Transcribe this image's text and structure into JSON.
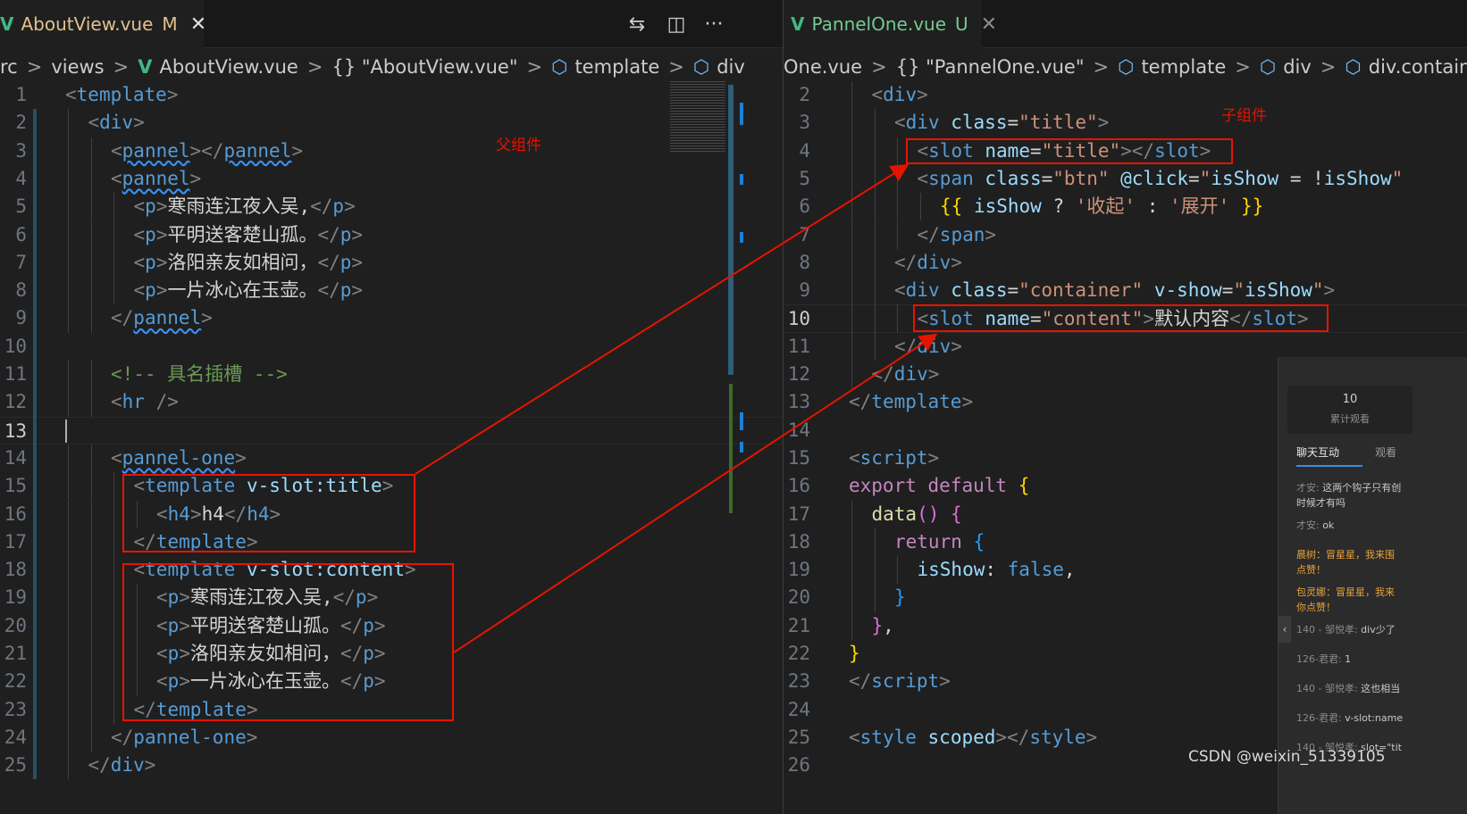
{
  "left": {
    "tab": {
      "name": "AboutView.vue",
      "status": "M",
      "close": "✕"
    },
    "toolbar": {
      "compare": "⇆",
      "split": "◫",
      "more": "···"
    },
    "breadcrumb": [
      "rc",
      "views",
      "AboutView.vue",
      "{} \"AboutView.vue\"",
      "template",
      "div"
    ],
    "line_numbers": [
      "1",
      "2",
      "3",
      "4",
      "5",
      "6",
      "7",
      "8",
      "9",
      "10",
      "11",
      "12",
      "13",
      "14",
      "15",
      "16",
      "17",
      "18",
      "19",
      "20",
      "21",
      "22",
      "23",
      "24",
      "25"
    ],
    "current_line": "13",
    "annotation": "父组件",
    "lines": [
      [
        [
          "t-br",
          "<"
        ],
        [
          "t-tag",
          "template"
        ],
        [
          "t-br",
          ">"
        ]
      ],
      [
        [
          "t-br",
          "<"
        ],
        [
          "t-tag",
          "div"
        ],
        [
          "t-br",
          ">"
        ]
      ],
      [
        [
          "t-br",
          "<"
        ],
        [
          "t-tag squig",
          "pannel"
        ],
        [
          "t-br",
          "></"
        ],
        [
          "t-tag squig",
          "pannel"
        ],
        [
          "t-br",
          ">"
        ]
      ],
      [
        [
          "t-br",
          "<"
        ],
        [
          "t-tag squig",
          "pannel"
        ],
        [
          "t-br",
          ">"
        ]
      ],
      [
        [
          "t-br",
          "<"
        ],
        [
          "t-tag",
          "p"
        ],
        [
          "t-br",
          ">"
        ],
        [
          "t-txt",
          "寒雨连江夜入吴,"
        ],
        [
          "t-br",
          "</"
        ],
        [
          "t-tag",
          "p"
        ],
        [
          "t-br",
          ">"
        ]
      ],
      [
        [
          "t-br",
          "<"
        ],
        [
          "t-tag",
          "p"
        ],
        [
          "t-br",
          ">"
        ],
        [
          "t-txt",
          "平明送客楚山孤。"
        ],
        [
          "t-br",
          "</"
        ],
        [
          "t-tag",
          "p"
        ],
        [
          "t-br",
          ">"
        ]
      ],
      [
        [
          "t-br",
          "<"
        ],
        [
          "t-tag",
          "p"
        ],
        [
          "t-br",
          ">"
        ],
        [
          "t-txt",
          "洛阳亲友如相问，"
        ],
        [
          "t-br",
          "</"
        ],
        [
          "t-tag",
          "p"
        ],
        [
          "t-br",
          ">"
        ]
      ],
      [
        [
          "t-br",
          "<"
        ],
        [
          "t-tag",
          "p"
        ],
        [
          "t-br",
          ">"
        ],
        [
          "t-txt",
          "一片冰心在玉壶。"
        ],
        [
          "t-br",
          "</"
        ],
        [
          "t-tag",
          "p"
        ],
        [
          "t-br",
          ">"
        ]
      ],
      [
        [
          "t-br",
          "</"
        ],
        [
          "t-tag squig",
          "pannel"
        ],
        [
          "t-br",
          ">"
        ]
      ],
      [],
      [
        [
          "t-com",
          "<!-- 具名插槽 -->"
        ]
      ],
      [
        [
          "t-br",
          "<"
        ],
        [
          "t-tag",
          "hr"
        ],
        [
          "t-txt",
          " "
        ],
        [
          "t-br",
          "/>"
        ]
      ],
      [],
      [
        [
          "t-br",
          "<"
        ],
        [
          "t-tag squig",
          "pannel-one"
        ],
        [
          "t-br",
          ">"
        ]
      ],
      [
        [
          "t-br",
          "<"
        ],
        [
          "t-tag",
          "template"
        ],
        [
          "t-txt",
          " "
        ],
        [
          "t-attr",
          "v-slot:title"
        ],
        [
          "t-br",
          ">"
        ]
      ],
      [
        [
          "t-br",
          "<"
        ],
        [
          "t-tag",
          "h4"
        ],
        [
          "t-br",
          ">"
        ],
        [
          "t-txt",
          "h4"
        ],
        [
          "t-br",
          "</"
        ],
        [
          "t-tag",
          "h4"
        ],
        [
          "t-br",
          ">"
        ]
      ],
      [
        [
          "t-br",
          "</"
        ],
        [
          "t-tag",
          "template"
        ],
        [
          "t-br",
          ">"
        ]
      ],
      [
        [
          "t-br",
          "<"
        ],
        [
          "t-tag",
          "template"
        ],
        [
          "t-txt",
          " "
        ],
        [
          "t-attr",
          "v-slot:content"
        ],
        [
          "t-br",
          ">"
        ]
      ],
      [
        [
          "t-br",
          "<"
        ],
        [
          "t-tag",
          "p"
        ],
        [
          "t-br",
          ">"
        ],
        [
          "t-txt",
          "寒雨连江夜入吴,"
        ],
        [
          "t-br",
          "</"
        ],
        [
          "t-tag",
          "p"
        ],
        [
          "t-br",
          ">"
        ]
      ],
      [
        [
          "t-br",
          "<"
        ],
        [
          "t-tag",
          "p"
        ],
        [
          "t-br",
          ">"
        ],
        [
          "t-txt",
          "平明送客楚山孤。"
        ],
        [
          "t-br",
          "</"
        ],
        [
          "t-tag",
          "p"
        ],
        [
          "t-br",
          ">"
        ]
      ],
      [
        [
          "t-br",
          "<"
        ],
        [
          "t-tag",
          "p"
        ],
        [
          "t-br",
          ">"
        ],
        [
          "t-txt",
          "洛阳亲友如相问，"
        ],
        [
          "t-br",
          "</"
        ],
        [
          "t-tag",
          "p"
        ],
        [
          "t-br",
          ">"
        ]
      ],
      [
        [
          "t-br",
          "<"
        ],
        [
          "t-tag",
          "p"
        ],
        [
          "t-br",
          ">"
        ],
        [
          "t-txt",
          "一片冰心在玉壶。"
        ],
        [
          "t-br",
          "</"
        ],
        [
          "t-tag",
          "p"
        ],
        [
          "t-br",
          ">"
        ]
      ],
      [
        [
          "t-br",
          "</"
        ],
        [
          "t-tag",
          "template"
        ],
        [
          "t-br",
          ">"
        ]
      ],
      [
        [
          "t-br",
          "</"
        ],
        [
          "t-tag",
          "pannel-one"
        ],
        [
          "t-br",
          ">"
        ]
      ],
      [
        [
          "t-br",
          "</"
        ],
        [
          "t-tag",
          "div"
        ],
        [
          "t-br",
          ">"
        ]
      ]
    ]
  },
  "right": {
    "tab": {
      "name": "PannelOne.vue",
      "status": "U",
      "close": "✕"
    },
    "breadcrumb": [
      "One.vue",
      "{} \"PannelOne.vue\"",
      "template",
      "div",
      "div.container"
    ],
    "line_numbers": [
      "2",
      "3",
      "4",
      "5",
      "6",
      "7",
      "8",
      "9",
      "10",
      "11",
      "12",
      "13",
      "14",
      "15",
      "16",
      "17",
      "18",
      "19",
      "20",
      "21",
      "22",
      "23",
      "24",
      "25",
      "26"
    ],
    "current_line": "10",
    "annotation": "子组件",
    "lines": [
      [
        [
          "t-br",
          "<"
        ],
        [
          "t-tag",
          "div"
        ],
        [
          "t-br",
          ">"
        ]
      ],
      [
        [
          "t-br",
          "<"
        ],
        [
          "t-tag",
          "div"
        ],
        [
          "t-txt",
          " "
        ],
        [
          "t-attr",
          "class"
        ],
        [
          "t-txt",
          "="
        ],
        [
          "t-str",
          "\"title\""
        ],
        [
          "t-br",
          ">"
        ]
      ],
      [
        [
          "t-br",
          "<"
        ],
        [
          "t-tag",
          "slot"
        ],
        [
          "t-txt",
          " "
        ],
        [
          "t-attr",
          "name"
        ],
        [
          "t-txt",
          "="
        ],
        [
          "t-str",
          "\"title\""
        ],
        [
          "t-br",
          "></"
        ],
        [
          "t-tag",
          "slot"
        ],
        [
          "t-br",
          ">"
        ]
      ],
      [
        [
          "t-br",
          "<"
        ],
        [
          "t-tag",
          "span"
        ],
        [
          "t-txt",
          " "
        ],
        [
          "t-attr",
          "class"
        ],
        [
          "t-txt",
          "="
        ],
        [
          "t-str",
          "\"btn\""
        ],
        [
          "t-txt",
          " "
        ],
        [
          "t-attr",
          "@click"
        ],
        [
          "t-txt",
          "="
        ],
        [
          "t-str",
          "\""
        ],
        [
          "t-attr",
          "isShow"
        ],
        [
          "t-txt",
          " = !"
        ],
        [
          "t-attr",
          "isShow"
        ],
        [
          "t-str",
          "\""
        ]
      ],
      [
        [
          "t-b1",
          "{{"
        ],
        [
          "t-txt",
          " "
        ],
        [
          "t-attr",
          "isShow"
        ],
        [
          "t-txt",
          " ? "
        ],
        [
          "t-str",
          "'收起'"
        ],
        [
          "t-txt",
          " : "
        ],
        [
          "t-str",
          "'展开'"
        ],
        [
          "t-txt",
          " "
        ],
        [
          "t-b1",
          "}}"
        ]
      ],
      [
        [
          "t-br",
          "</"
        ],
        [
          "t-tag",
          "span"
        ],
        [
          "t-br",
          ">"
        ]
      ],
      [
        [
          "t-br",
          "</"
        ],
        [
          "t-tag",
          "div"
        ],
        [
          "t-br",
          ">"
        ]
      ],
      [
        [
          "t-br",
          "<"
        ],
        [
          "t-tag",
          "div"
        ],
        [
          "t-txt",
          " "
        ],
        [
          "t-attr",
          "class"
        ],
        [
          "t-txt",
          "="
        ],
        [
          "t-str",
          "\"container\""
        ],
        [
          "t-txt",
          " "
        ],
        [
          "t-attr",
          "v-show"
        ],
        [
          "t-txt",
          "="
        ],
        [
          "t-str",
          "\""
        ],
        [
          "t-attr",
          "isShow"
        ],
        [
          "t-str",
          "\""
        ],
        [
          "t-br",
          ">"
        ]
      ],
      [
        [
          "t-br",
          "<"
        ],
        [
          "t-tag",
          "slot"
        ],
        [
          "t-txt",
          " "
        ],
        [
          "t-attr",
          "name"
        ],
        [
          "t-txt",
          "="
        ],
        [
          "t-str",
          "\"content\""
        ],
        [
          "t-br",
          ">"
        ],
        [
          "t-txt",
          "默认内容"
        ],
        [
          "t-br",
          "</"
        ],
        [
          "t-tag",
          "slot"
        ],
        [
          "t-br",
          ">"
        ]
      ],
      [
        [
          "t-br",
          "</"
        ],
        [
          "t-tag",
          "div"
        ],
        [
          "t-br",
          ">"
        ]
      ],
      [
        [
          "t-br",
          "</"
        ],
        [
          "t-tag",
          "div"
        ],
        [
          "t-br",
          ">"
        ]
      ],
      [
        [
          "t-br",
          "</"
        ],
        [
          "t-tag",
          "template"
        ],
        [
          "t-br",
          ">"
        ]
      ],
      [],
      [
        [
          "t-br",
          "<"
        ],
        [
          "t-tag",
          "script"
        ],
        [
          "t-br",
          ">"
        ]
      ],
      [
        [
          "t-kw",
          "export"
        ],
        [
          "t-txt",
          " "
        ],
        [
          "t-kw",
          "default"
        ],
        [
          "t-txt",
          " "
        ],
        [
          "t-b1",
          "{"
        ]
      ],
      [
        [
          "t-fn",
          "data"
        ],
        [
          "t-b2",
          "()"
        ],
        [
          "t-txt",
          " "
        ],
        [
          "t-b2",
          "{"
        ]
      ],
      [
        [
          "t-kw",
          "return"
        ],
        [
          "t-txt",
          " "
        ],
        [
          "t-b3",
          "{"
        ]
      ],
      [
        [
          "t-attr",
          "isShow"
        ],
        [
          "t-txt",
          ": "
        ],
        [
          "t-val",
          "false"
        ],
        [
          "t-txt",
          ","
        ]
      ],
      [
        [
          "t-b3",
          "}"
        ]
      ],
      [
        [
          "t-b2",
          "}"
        ],
        [
          "t-txt",
          ","
        ]
      ],
      [
        [
          "t-b1",
          "}"
        ]
      ],
      [
        [
          "t-br",
          "</"
        ],
        [
          "t-tag",
          "script"
        ],
        [
          "t-br",
          ">"
        ]
      ],
      [],
      [
        [
          "t-br",
          "<"
        ],
        [
          "t-tag",
          "style"
        ],
        [
          "t-txt",
          " "
        ],
        [
          "t-attr",
          "scoped"
        ],
        [
          "t-br",
          "></"
        ],
        [
          "t-tag",
          "style"
        ],
        [
          "t-br",
          ">"
        ]
      ],
      []
    ]
  },
  "chat": {
    "stat_value": "10",
    "stat_label": "累计观看",
    "tab_chat": "聊天互动",
    "tab_viewers": "观看",
    "messages": [
      {
        "user": "才安:",
        "text": "这两个钩子只有创",
        "text2": "时候才有吗",
        "highlight": false
      },
      {
        "user": "才安:",
        "text": "ok",
        "text2": "",
        "highlight": false
      },
      {
        "user": "",
        "text": "晨树：冒星星，我来围",
        "text2": "点赞！",
        "highlight": true
      },
      {
        "user": "",
        "text": "包灵娜：冒星星，我来",
        "text2": "你点赞！",
        "highlight": true
      },
      {
        "user": "140 - 邹悦孝:",
        "text": "div少了",
        "text2": "",
        "highlight": false
      },
      {
        "user": "126-君君:",
        "text": "1",
        "text2": "",
        "highlight": false
      },
      {
        "user": "140 - 邹悦孝:",
        "text": "这也相当",
        "text2": "",
        "highlight": false
      },
      {
        "user": "126-君君:",
        "text": "v-slot:name",
        "text2": "",
        "highlight": false
      },
      {
        "user": "140 - 邹悦孝:",
        "text": "slot=\"tit",
        "text2": "",
        "highlight": false
      }
    ]
  },
  "watermark": "CSDN @weixin_51339105"
}
